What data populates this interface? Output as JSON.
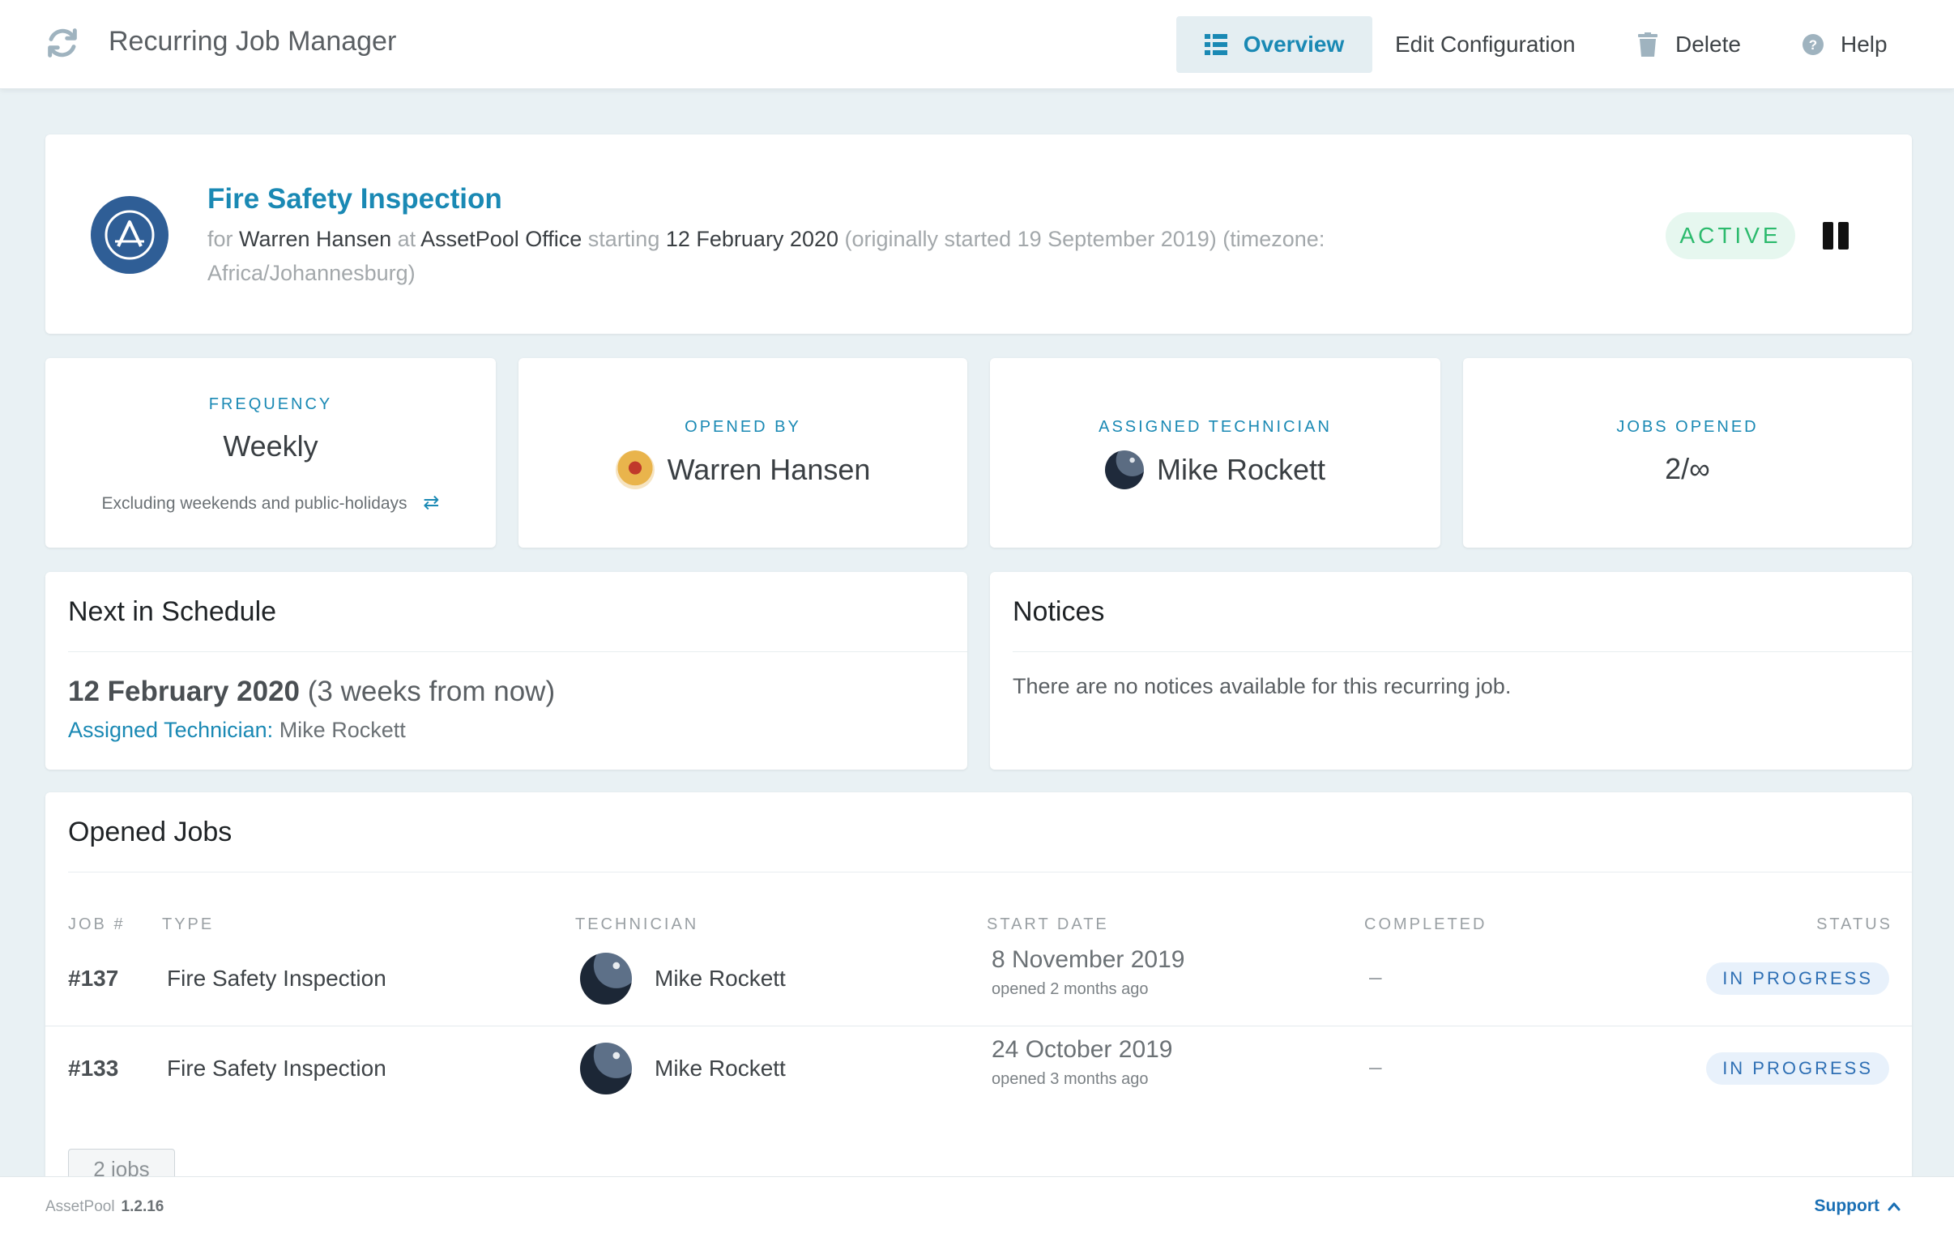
{
  "app": {
    "title": "Recurring Job Manager"
  },
  "nav": {
    "overview": "Overview",
    "edit": "Edit Configuration",
    "delete": "Delete",
    "help": "Help"
  },
  "hero": {
    "title": "Fire Safety Inspection",
    "for_word": "for",
    "owner": "Warren Hansen",
    "at_word": "at",
    "site": "AssetPool Office",
    "starting_word": "starting",
    "start_date": "12 February 2020",
    "original": "(originally started 19 September 2019) (timezone: Africa/Johannesburg)",
    "status": "ACTIVE"
  },
  "stats": {
    "frequency": {
      "label": "FREQUENCY",
      "value": "Weekly",
      "note": "Excluding weekends and public-holidays"
    },
    "opened_by": {
      "label": "OPENED BY",
      "value": "Warren Hansen"
    },
    "technician": {
      "label": "ASSIGNED TECHNICIAN",
      "value": "Mike Rockett"
    },
    "jobs_opened": {
      "label": "JOBS OPENED",
      "value": "2/∞"
    }
  },
  "schedule": {
    "title": "Next in Schedule",
    "date": "12 February 2020",
    "relative": "(3 weeks from now)",
    "tech_label": "Assigned Technician:",
    "tech_value": "Mike Rockett"
  },
  "notices": {
    "title": "Notices",
    "text": "There are no notices available for this recurring job."
  },
  "jobs": {
    "title": "Opened Jobs",
    "columns": {
      "job": "JOB #",
      "type": "TYPE",
      "technician": "TECHNICIAN",
      "start": "START DATE",
      "completed": "COMPLETED",
      "status": "STATUS"
    },
    "rows": [
      {
        "job": "#137",
        "type": "Fire Safety Inspection",
        "technician": "Mike Rockett",
        "start": "8 November 2019",
        "opened": "opened 2 months ago",
        "completed": "–",
        "status": "IN PROGRESS"
      },
      {
        "job": "#133",
        "type": "Fire Safety Inspection",
        "technician": "Mike Rockett",
        "start": "24 October 2019",
        "opened": "opened 3 months ago",
        "completed": "–",
        "status": "IN PROGRESS"
      }
    ],
    "count": "2 jobs"
  },
  "footer": {
    "brand": "AssetPool",
    "version": "1.2.16",
    "support": "Support"
  },
  "colors": {
    "accent": "#1a89b4",
    "active": "#2cba6d",
    "badge": "#2e6fb4"
  }
}
